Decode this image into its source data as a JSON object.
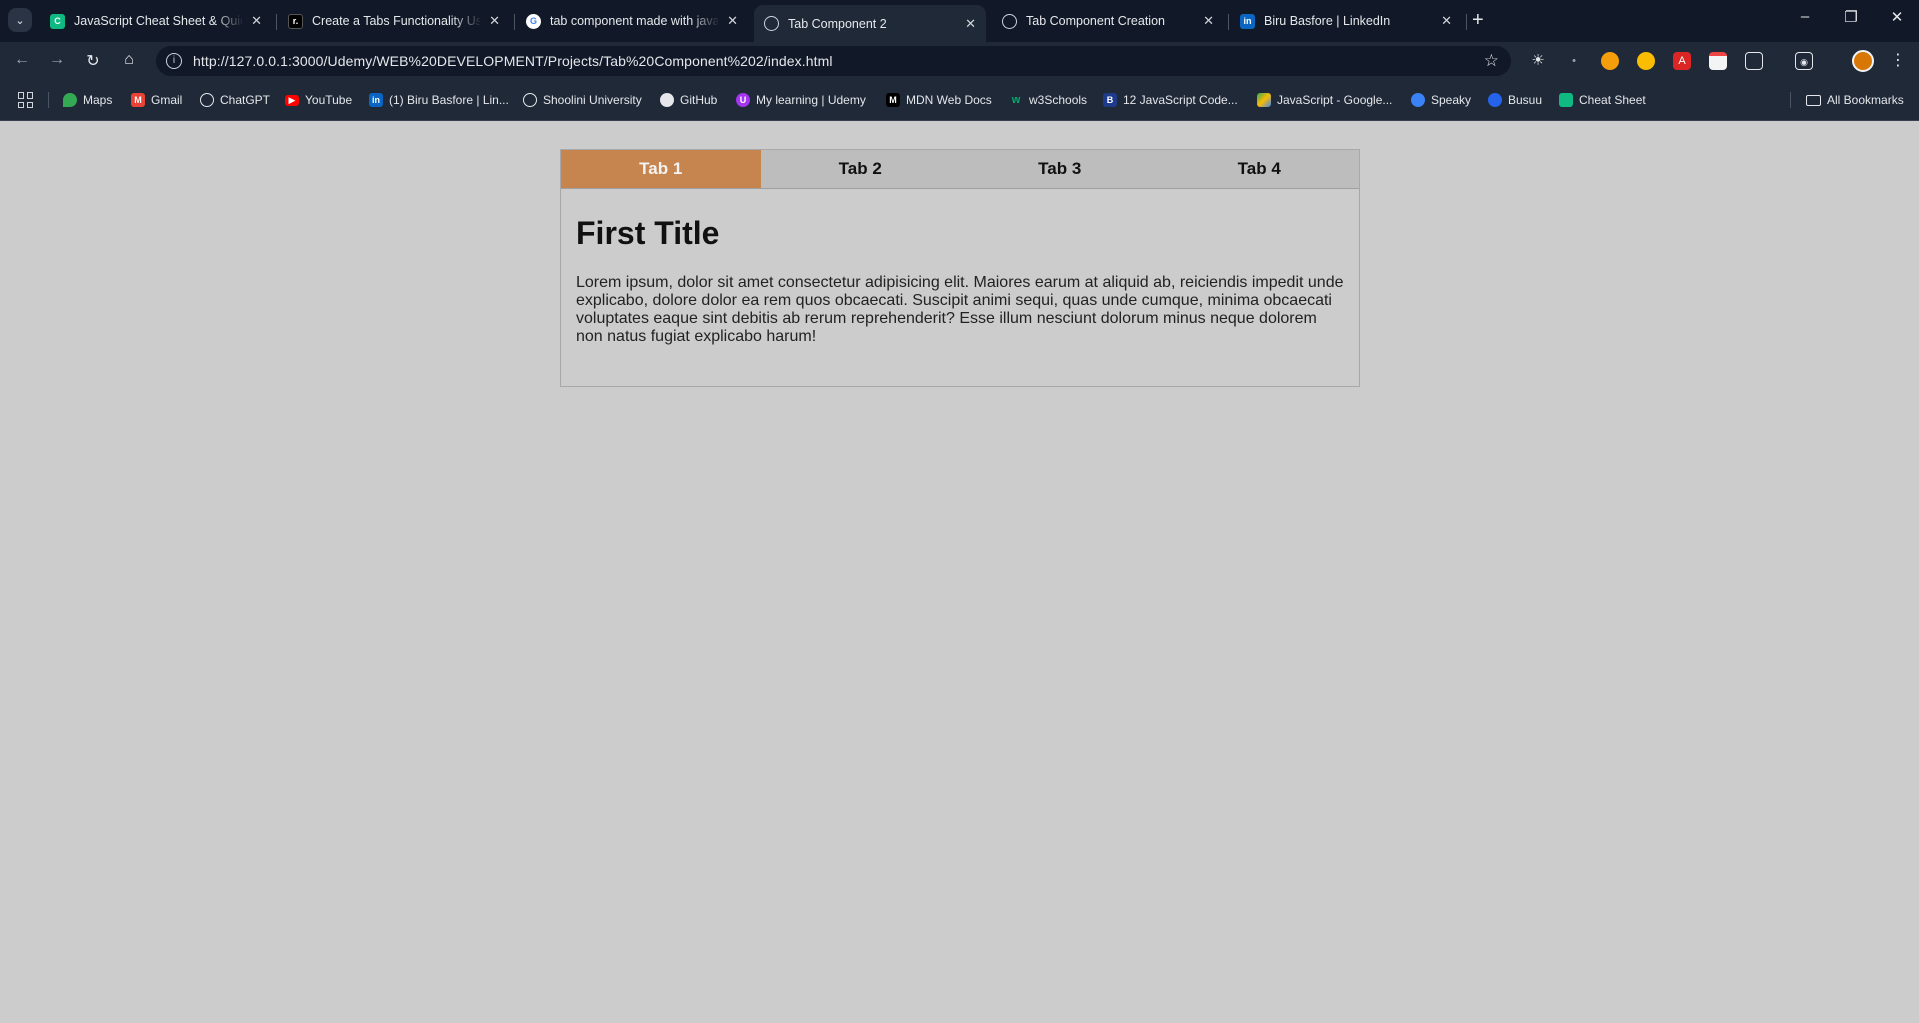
{
  "browser": {
    "tabs": [
      {
        "title": "JavaScript Cheat Sheet & Quick",
        "favicon_color": "#10b981"
      },
      {
        "title": "Create a Tabs Functionality Usin",
        "favicon_color": "#000000"
      },
      {
        "title": "tab component made with java",
        "favicon_color": "#ffffff"
      },
      {
        "title": "Tab Component 2",
        "favicon_color": "#9ca3af"
      },
      {
        "title": "Tab Component Creation",
        "favicon_color": "#9ca3af"
      },
      {
        "title": "Biru Basfore | LinkedIn",
        "favicon_color": "#0a66c2"
      }
    ],
    "active_tab_index": 3,
    "url": "http://127.0.0.1:3000/Udemy/WEB%20DEVELOPMENT/Projects/Tab%20Component%202/index.html",
    "bookmarks": [
      {
        "label": "Maps",
        "color": "#34a853"
      },
      {
        "label": "Gmail",
        "color": "#ea4335"
      },
      {
        "label": "ChatGPT",
        "color": "#9ca3af"
      },
      {
        "label": "YouTube",
        "color": "#ff0000"
      },
      {
        "label": "(1) Biru Basfore | Lin...",
        "color": "#0a66c2"
      },
      {
        "label": "Shoolini University",
        "color": "#9ca3af"
      },
      {
        "label": "GitHub",
        "color": "#e5e7eb"
      },
      {
        "label": "My learning | Udemy",
        "color": "#a435f0"
      },
      {
        "label": "MDN Web Docs",
        "color": "#000000"
      },
      {
        "label": "w3Schools",
        "color": "#04aa6d"
      },
      {
        "label": "12 JavaScript Code...",
        "color": "#1e3a8a"
      },
      {
        "label": "JavaScript - Google...",
        "color": "#fbbc04"
      },
      {
        "label": "Speaky",
        "color": "#3b82f6"
      },
      {
        "label": "Busuu",
        "color": "#2563eb"
      },
      {
        "label": "Cheat Sheet",
        "color": "#10b981"
      }
    ],
    "all_bookmarks": "All Bookmarks"
  },
  "page": {
    "tabs": [
      {
        "label": "Tab 1"
      },
      {
        "label": "Tab 2"
      },
      {
        "label": "Tab 3"
      },
      {
        "label": "Tab 4"
      }
    ],
    "active_tab": 0,
    "accent_color": "#c6844f",
    "content": {
      "title": "First Title",
      "body": "Lorem ipsum, dolor sit amet consectetur adipisicing elit. Maiores earum at aliquid ab, reiciendis impedit unde explicabo, dolore dolor ea rem quos obcaecati. Suscipit animi sequi, quas unde cumque, minima obcaecati voluptates eaque sint debitis ab rerum reprehenderit? Esse illum nesciunt dolorum minus neque dolorem non natus fugiat explicabo harum!"
    }
  }
}
